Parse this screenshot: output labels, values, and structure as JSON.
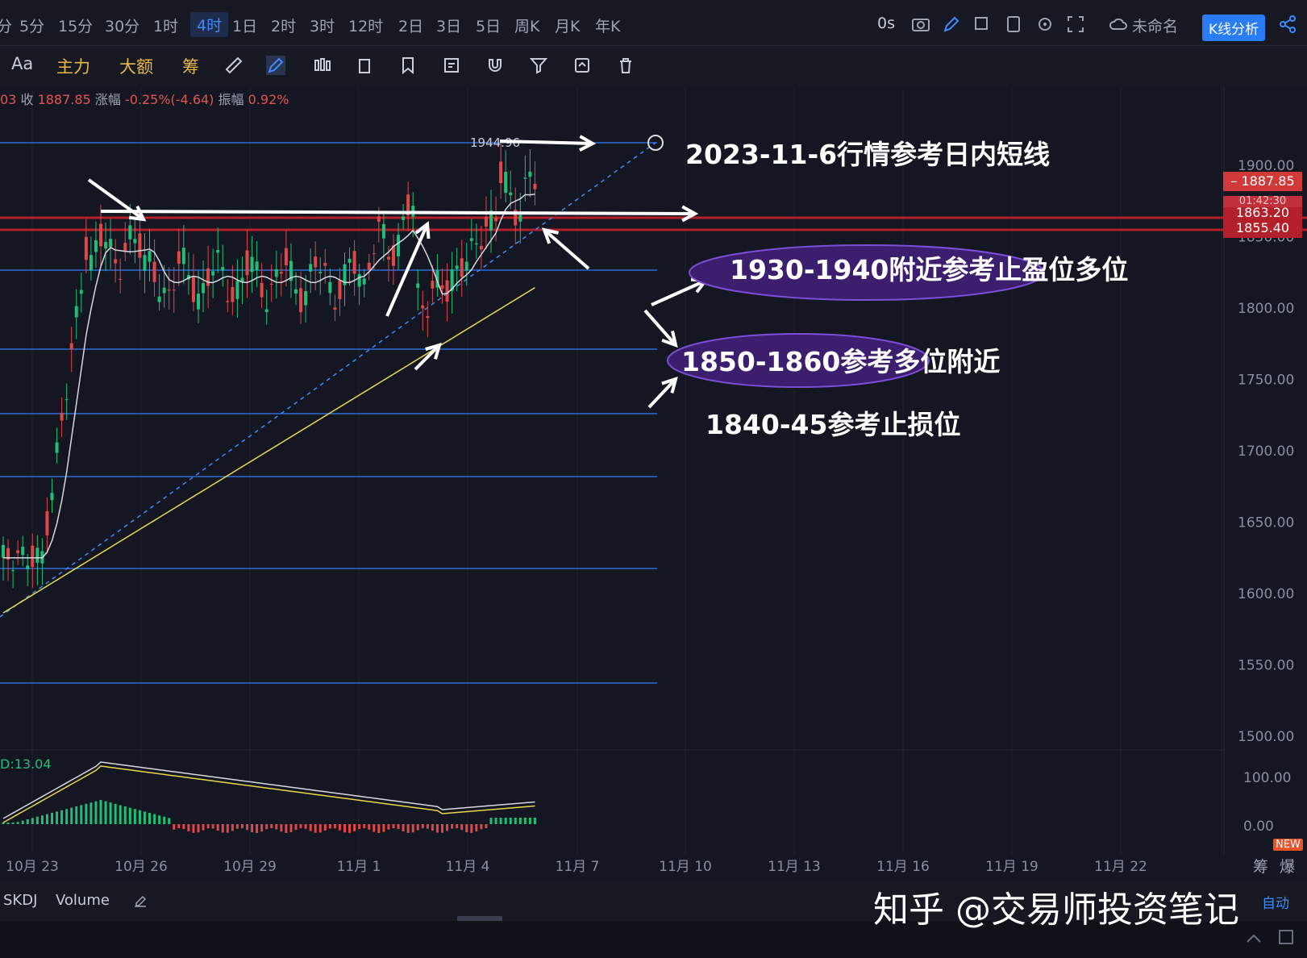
{
  "toolbar": {
    "timeframes": [
      "分",
      "5分",
      "15分",
      "30分",
      "1时",
      "4时",
      "1日",
      "2时",
      "3时",
      "12时",
      "2日",
      "3日",
      "5日",
      "周K",
      "月K",
      "年K"
    ],
    "active_timeframe": "4时",
    "countdown": "0s",
    "layout_name": "未命名",
    "kline_button": "K线分析",
    "tools": [
      "Aa",
      "主力",
      "大额",
      "筹"
    ]
  },
  "info_line": {
    "prefix": "03",
    "close_label": "收",
    "close_value": "1887.85",
    "change_label": "涨幅",
    "change_value": "-0.25%(-4.64)",
    "amplitude_label": "振幅",
    "amplitude_value": "0.92%"
  },
  "chart_data": {
    "type": "candlestick",
    "title": "2023-11-6行情参考日内短线",
    "y_ticks": [
      "1900.00",
      "1850.00",
      "1800.00",
      "1750.00",
      "1700.00",
      "1650.00",
      "1600.00",
      "1550.00",
      "1500.00"
    ],
    "x_ticks": [
      "10月 23",
      "10月 26",
      "10月 29",
      "11月 1",
      "11月 4",
      "11月 7",
      "11月 10",
      "11月 13",
      "11月 16",
      "11月 19",
      "11月 22"
    ],
    "high_label": "1944.96",
    "current_price": "1887.85",
    "hidden_price": "01:42:30",
    "level_top": "1863.20",
    "level_bottom": "1855.40",
    "indicator_label": "D:13.04",
    "indicator_ticks": [
      "100.00",
      "0.00"
    ],
    "annotations": [
      "1930-1940附近参考止盈位多位",
      "1850-1860参考多位附近",
      "1840-45参考止损位"
    ],
    "colors": {
      "up": "#1fbf7a",
      "down": "#e04848",
      "ma_white": "#d8d8e0",
      "ma_yellow": "#e8d84a",
      "hline": "#2d6bd8",
      "redline": "#b3202a",
      "annotation_fill": "#3c1e6e"
    }
  },
  "bottom": {
    "indicators": [
      "SKDJ",
      "Volume"
    ],
    "auto_label": "自动",
    "new_badge": "NEW",
    "right_labels": [
      "筹",
      "爆"
    ]
  },
  "watermark": "知乎 @交易师投资笔记"
}
